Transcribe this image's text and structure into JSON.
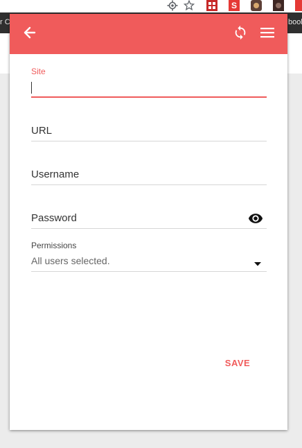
{
  "browser": {
    "bookmark_left": "r C",
    "bookmark_right": "book",
    "ext_s_label": "S"
  },
  "popup": {
    "icons": {
      "back": "arrow-left-icon",
      "sync": "sync-icon",
      "menu": "hamburger-menu-icon",
      "visibility": "eye-icon",
      "dropdown": "caret-down-icon"
    },
    "form": {
      "site_label": "Site",
      "site_value": "",
      "url_placeholder": "URL",
      "username_placeholder": "Username",
      "password_placeholder": "Password",
      "permissions_label": "Permissions",
      "permissions_value": "All users selected."
    },
    "save_label": "SAVE"
  },
  "colors": {
    "accent": "#f05b5b",
    "background": "#ececec"
  }
}
